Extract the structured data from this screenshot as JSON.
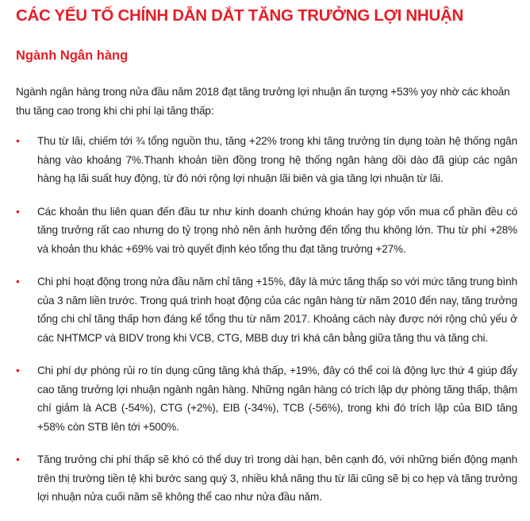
{
  "colors": {
    "heading": "#e41e26",
    "body_text": "#231f20",
    "bullet": "#e41e26",
    "background": "#ffffff"
  },
  "document": {
    "title": "CÁC YẾU TỐ CHÍNH DẪN DẮT TĂNG TRƯỞNG LỢI NHUẬN",
    "section_heading": "Ngành Ngân hàng",
    "intro": "Ngành ngân hàng trong nửa đầu năm 2018 đạt tăng trưởng lợi nhuận ấn tượng +53% yoy nhờ các khoản thu tăng cao trong khi chi phí lại tăng thấp:",
    "bullet_symbol": "•",
    "bullets": [
      "Thu từ lãi, chiếm tới ¾ tổng nguồn thu, tăng +22% trong khi tăng trưởng tín dụng toàn hệ thống ngân hàng vào khoảng 7%.Thanh khoản tiền đồng trong hệ thống ngân hàng dồi dào đã giúp các ngân hàng hạ lãi suất huy động, từ đó nới rộng lợi nhuận lãi biên và gia tăng lợi nhuận từ lãi.",
      "Các khoản thu liên quan đến đầu tư như kinh doanh chứng khoán hay góp vốn mua cổ phần đều có tăng trưởng rất cao nhưng do tỷ trọng nhỏ nên ảnh hưởng đến tổng thu không lớn. Thu từ phí +28% và khoản thu khác +69% vai trò quyết định kéo tổng thu đạt tăng trưởng +27%.",
      "Chi phí hoạt động trong nửa đầu năm chỉ tăng +15%, đây là mức tăng thấp so với mức tăng trung bình của 3 năm liền trước. Trong quá trình hoạt động của các ngân hàng từ năm 2010 đến nay, tăng trưởng tổng chi chỉ tăng thấp hơn đáng kể tổng thu từ năm 2017. Khoảng cách này được nới rộng chủ yếu ở các NHTMCP và BIDV trong khi VCB, CTG, MBB duy trì khá cân bằng giữa tăng thu và tăng chi.",
      "Chi phí dự phòng rủi ro tín dụng cũng tăng khá thấp, +19%, đây có thể coi là động lực thứ 4 giúp đẩy cao tăng trưởng lợi nhuận ngành ngân hàng. Những ngân hàng có trích lập dự phòng tăng thấp, thậm chí giảm là ACB (-54%), CTG (+2%), EIB (-34%), TCB (-56%), trong khi đó trích lập của BID tăng +58% còn STB lên tới +500%.",
      "Tăng trưởng chi phí thấp sẽ khó có thể duy trì trong dài hạn, bên cạnh đó, với những biến động mạnh trên thị trường tiền tệ khi bước sang quý 3, nhiều khả năng thu từ lãi cũng sẽ bị co hẹp và tăng trưởng lợi nhuận nửa cuối năm sẽ không thể cao như nửa đầu năm."
    ]
  }
}
